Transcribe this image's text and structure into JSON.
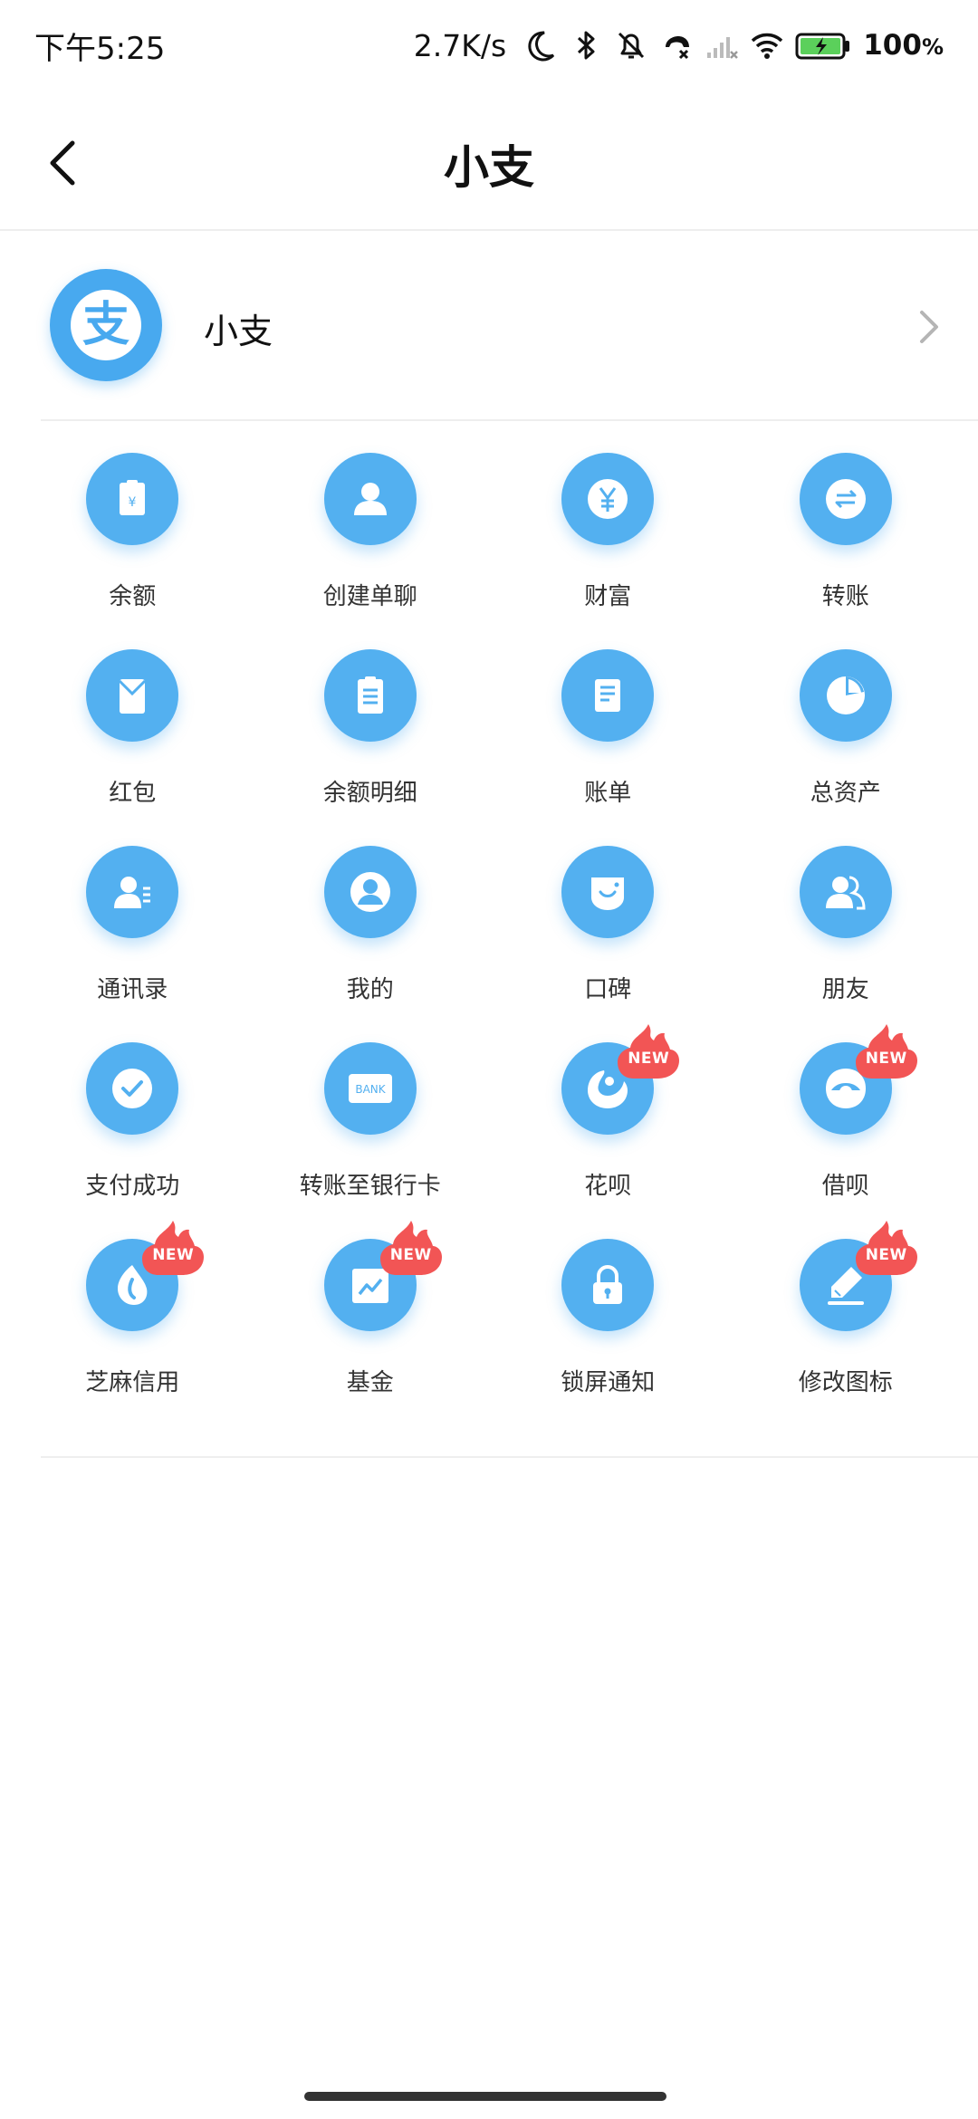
{
  "status_bar": {
    "time": "下午5:25",
    "net_speed": "2.7K/s",
    "battery_pct": "100",
    "battery_unit": "%",
    "icons": [
      "moon-icon",
      "bluetooth-icon",
      "mute-bell-icon",
      "call-icon",
      "signal-icon",
      "wifi-icon",
      "battery-charging-icon"
    ]
  },
  "header": {
    "title": "小支"
  },
  "profile": {
    "name": "小支",
    "avatar_glyph": "支"
  },
  "colors": {
    "icon_blue": "#53b0f0",
    "badge_red": "#f25555",
    "divider": "#eeeeee"
  },
  "badge_text": "NEW",
  "grid": {
    "items": [
      {
        "label": "余额",
        "icon": "wallet-icon",
        "new": false
      },
      {
        "label": "创建单聊",
        "icon": "person-icon",
        "new": false
      },
      {
        "label": "财富",
        "icon": "yuan-coin-icon",
        "new": false
      },
      {
        "label": "转账",
        "icon": "transfer-icon",
        "new": false
      },
      {
        "label": "红包",
        "icon": "red-packet-icon",
        "new": false
      },
      {
        "label": "余额明细",
        "icon": "clipboard-icon",
        "new": false
      },
      {
        "label": "账单",
        "icon": "bill-icon",
        "new": false
      },
      {
        "label": "总资产",
        "icon": "pie-chart-icon",
        "new": false
      },
      {
        "label": "通讯录",
        "icon": "contacts-icon",
        "new": false
      },
      {
        "label": "我的",
        "icon": "user-circle-icon",
        "new": false
      },
      {
        "label": "口碑",
        "icon": "koubei-icon",
        "new": false
      },
      {
        "label": "朋友",
        "icon": "friends-icon",
        "new": false
      },
      {
        "label": "支付成功",
        "icon": "check-circle-icon",
        "new": false
      },
      {
        "label": "转账至银行卡",
        "icon": "bank-card-icon",
        "new": false
      },
      {
        "label": "花呗",
        "icon": "huabei-icon",
        "new": true
      },
      {
        "label": "借呗",
        "icon": "jiebei-icon",
        "new": true
      },
      {
        "label": "芝麻信用",
        "icon": "sesame-icon",
        "new": true
      },
      {
        "label": "基金",
        "icon": "fund-chart-icon",
        "new": true
      },
      {
        "label": "锁屏通知",
        "icon": "lock-icon",
        "new": false
      },
      {
        "label": "修改图标",
        "icon": "pencil-icon",
        "new": true
      }
    ]
  }
}
